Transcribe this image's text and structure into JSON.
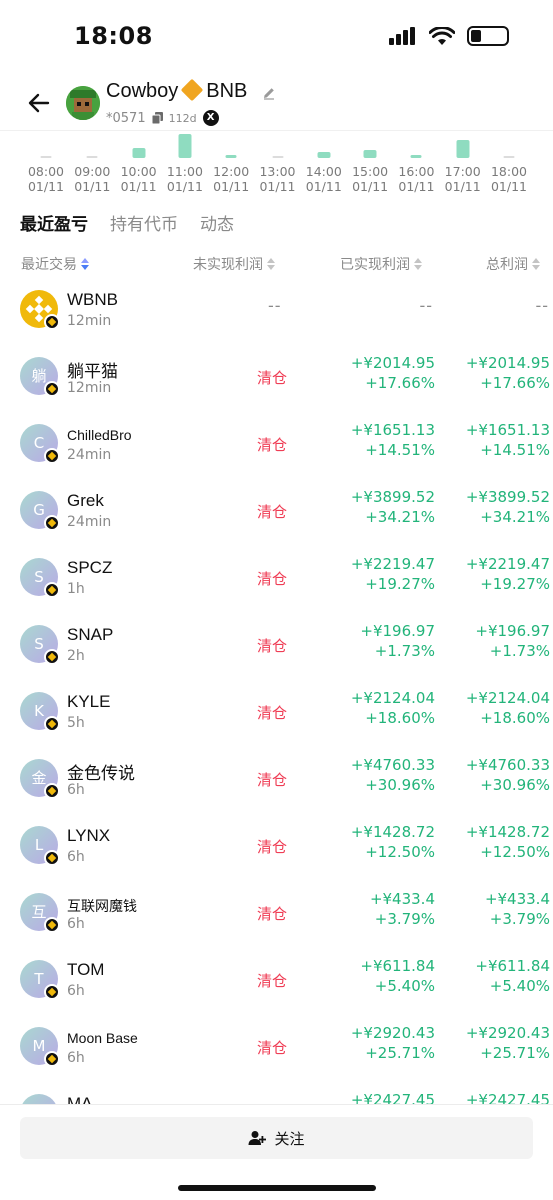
{
  "status": {
    "time": "18:08"
  },
  "header": {
    "name_left": "Cowboy",
    "name_right": "BNB",
    "address": "*0571",
    "age": "112d"
  },
  "mini_chart": [
    {
      "time": "08:00",
      "date": "01/11",
      "level": 0.1
    },
    {
      "time": "09:00",
      "date": "01/11",
      "level": 0.08
    },
    {
      "time": "10:00",
      "date": "01/11",
      "level": 0.4
    },
    {
      "time": "11:00",
      "date": "01/11",
      "level": 1.0
    },
    {
      "time": "12:00",
      "date": "01/11",
      "level": 0.12
    },
    {
      "time": "13:00",
      "date": "01/11",
      "level": 0.08
    },
    {
      "time": "14:00",
      "date": "01/11",
      "level": 0.25
    },
    {
      "time": "15:00",
      "date": "01/11",
      "level": 0.35
    },
    {
      "time": "16:00",
      "date": "01/11",
      "level": 0.12
    },
    {
      "time": "17:00",
      "date": "01/11",
      "level": 0.75
    },
    {
      "time": "18:00",
      "date": "01/11",
      "level": 0.08
    }
  ],
  "tabs": [
    "最近盈亏",
    "持有代币",
    "动态"
  ],
  "columns": {
    "recent": "最近交易",
    "unrealized": "未实现利润",
    "realized": "已实现利润",
    "total": "总利润"
  },
  "rows": [
    {
      "name": "WBNB",
      "time": "12min",
      "avatar": "",
      "unrealized": "--",
      "realized": "--",
      "realized_pct": "",
      "total": "--",
      "total_pct": ""
    },
    {
      "name": "躺平猫",
      "time": "12min",
      "avatar": "躺",
      "unrealized": "清仓",
      "realized": "+¥2014.95",
      "realized_pct": "+17.66%",
      "total": "+¥2014.95",
      "total_pct": "+17.66%"
    },
    {
      "name": "ChilledBro",
      "time": "24min",
      "avatar": "C",
      "unrealized": "清仓",
      "realized": "+¥1651.13",
      "realized_pct": "+14.51%",
      "total": "+¥1651.13",
      "total_pct": "+14.51%"
    },
    {
      "name": "Grek",
      "time": "24min",
      "avatar": "G",
      "unrealized": "清仓",
      "realized": "+¥3899.52",
      "realized_pct": "+34.21%",
      "total": "+¥3899.52",
      "total_pct": "+34.21%"
    },
    {
      "name": "SPCZ",
      "time": "1h",
      "avatar": "S",
      "unrealized": "清仓",
      "realized": "+¥2219.47",
      "realized_pct": "+19.27%",
      "total": "+¥2219.47",
      "total_pct": "+19.27%"
    },
    {
      "name": "SNAP",
      "time": "2h",
      "avatar": "S",
      "unrealized": "清仓",
      "realized": "+¥196.97",
      "realized_pct": "+1.73%",
      "total": "+¥196.97",
      "total_pct": "+1.73%"
    },
    {
      "name": "KYLE",
      "time": "5h",
      "avatar": "K",
      "unrealized": "清仓",
      "realized": "+¥2124.04",
      "realized_pct": "+18.60%",
      "total": "+¥2124.04",
      "total_pct": "+18.60%"
    },
    {
      "name": "金色传说",
      "time": "6h",
      "avatar": "金",
      "unrealized": "清仓",
      "realized": "+¥4760.33",
      "realized_pct": "+30.96%",
      "total": "+¥4760.33",
      "total_pct": "+30.96%"
    },
    {
      "name": "LYNX",
      "time": "6h",
      "avatar": "L",
      "unrealized": "清仓",
      "realized": "+¥1428.72",
      "realized_pct": "+12.50%",
      "total": "+¥1428.72",
      "total_pct": "+12.50%"
    },
    {
      "name": "互联网魔钱",
      "time": "6h",
      "avatar": "互",
      "unrealized": "清仓",
      "realized": "+¥433.4",
      "realized_pct": "+3.79%",
      "total": "+¥433.4",
      "total_pct": "+3.79%"
    },
    {
      "name": "TOM",
      "time": "6h",
      "avatar": "T",
      "unrealized": "清仓",
      "realized": "+¥611.84",
      "realized_pct": "+5.40%",
      "total": "+¥611.84",
      "total_pct": "+5.40%"
    },
    {
      "name": "Moon Base",
      "time": "6h",
      "avatar": "M",
      "unrealized": "清仓",
      "realized": "+¥2920.43",
      "realized_pct": "+25.71%",
      "total": "+¥2920.43",
      "total_pct": "+25.71%"
    },
    {
      "name": "MA",
      "time": "",
      "avatar": "M",
      "unrealized": "",
      "realized": "+¥2427.45",
      "realized_pct": "",
      "total": "+¥2427.45",
      "total_pct": ""
    }
  ],
  "follow_button": "关注",
  "colors": {
    "profit": "#22b47a",
    "closed": "#ef3d55",
    "sort_active": "#4b7cf5"
  },
  "icons": [
    "back-arrow-icon",
    "edit-pencil-icon",
    "copy-icon",
    "x-social-icon",
    "sort-icon",
    "add-user-icon",
    "signal-icon",
    "wifi-icon",
    "battery-icon"
  ]
}
